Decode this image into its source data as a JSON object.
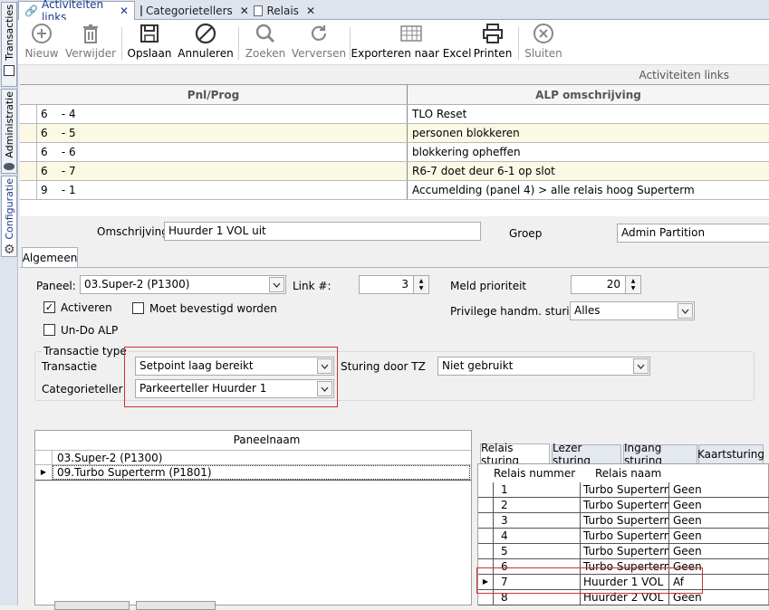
{
  "sidebar": {
    "tabs": [
      {
        "label": "Transacties"
      },
      {
        "label": "Administratie"
      },
      {
        "label": "Configuratie"
      }
    ]
  },
  "doc_tabs": [
    {
      "label": "Activiteiten links",
      "icon": "link-icon"
    },
    {
      "label": "Categorietellers",
      "icon": "counter-icon"
    },
    {
      "label": "Relais",
      "icon": "relay-icon"
    }
  ],
  "toolbar": {
    "new": "Nieuw",
    "delete": "Verwijder",
    "save": "Opslaan",
    "cancel": "Annuleren",
    "search": "Zoeken",
    "refresh": "Verversen",
    "export": "Exporteren naar Excel",
    "print": "Printen",
    "close": "Sluiten"
  },
  "grid": {
    "title": "Activiteiten links",
    "columns": [
      "Pnl/Prog",
      "ALP omschrijving"
    ],
    "rows": [
      {
        "pnl": "6    - 4",
        "desc": "TLO Reset"
      },
      {
        "pnl": "6    - 5",
        "desc": "personen blokkeren"
      },
      {
        "pnl": "6    - 6",
        "desc": "blokkering opheffen"
      },
      {
        "pnl": "6    - 7",
        "desc": "R6-7 doet deur 6-1 op slot"
      },
      {
        "pnl": "9    - 1",
        "desc": "Accumelding (panel 4) > alle relais hoog Superterm"
      }
    ]
  },
  "form": {
    "omschrijving_label": "Omschrijving",
    "omschrijving_value": "Huurder 1 VOL uit",
    "groep_label": "Groep",
    "groep_value": "Admin Partition",
    "tab_algemeen": "Algemeen",
    "paneel_label": "Paneel:",
    "paneel_value": "03.Super-2 (P1300)",
    "link_label": "Link #:",
    "link_value": "3",
    "meld_label": "Meld prioriteit",
    "meld_value": "20",
    "activeren_label": "Activeren",
    "bevestigd_label": "Moet bevestigd worden",
    "privilege_label": "Privilege handm. sturing:",
    "privilege_value": "Alles",
    "undo_label": "Un-Do ALP",
    "transactie_type_label": "Transactie type",
    "transactie_label": "Transactie",
    "transactie_value": "Setpoint laag bereikt",
    "sturing_label": "Sturing door TZ",
    "sturing_value": "Niet gebruikt",
    "categorieteller_label": "Categorieteller",
    "categorieteller_value": "Parkeerteller Huurder 1"
  },
  "panel_grid": {
    "header": "Paneelnaam",
    "rows": [
      "03.Super-2 (P1300)",
      "09.Turbo Superterm (P1801)"
    ]
  },
  "relais_tabs": [
    "Relais sturing",
    "Lezer sturing",
    "Ingang sturing",
    "Kaartsturing"
  ],
  "relais_grid": {
    "columns": [
      "Relais nummer",
      "Relais naam"
    ],
    "rows": [
      {
        "nr": "1",
        "naam": "Turbo Superterm",
        "val": "Geen"
      },
      {
        "nr": "2",
        "naam": "Turbo Superterm",
        "val": "Geen"
      },
      {
        "nr": "3",
        "naam": "Turbo Superterm",
        "val": "Geen"
      },
      {
        "nr": "4",
        "naam": "Turbo Superterm",
        "val": "Geen"
      },
      {
        "nr": "5",
        "naam": "Turbo Superterm",
        "val": "Geen"
      },
      {
        "nr": "6",
        "naam": "Turbo Superterm",
        "val": "Geen"
      },
      {
        "nr": "7",
        "naam": "Huurder 1 VOL",
        "val": "Af"
      },
      {
        "nr": "8",
        "naam": "Huurder 2 VOL",
        "val": "Geen"
      }
    ]
  },
  "colors": {
    "accent": "#1a3c8c",
    "highlight": "#d03030",
    "alt_row": "#fbf9e4"
  }
}
